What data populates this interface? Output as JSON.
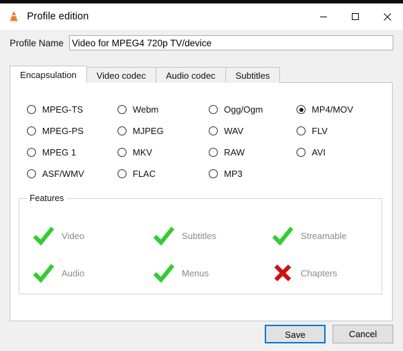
{
  "window": {
    "title": "Profile edition",
    "app_icon": "vlc-cone-icon",
    "controls": {
      "minimize": "minimize-icon",
      "maximize": "maximize-icon",
      "close": "close-icon"
    }
  },
  "profile": {
    "label": "Profile Name",
    "value": "Video for MPEG4 720p TV/device",
    "placeholder": ""
  },
  "tabs": [
    {
      "label": "Encapsulation",
      "active": true
    },
    {
      "label": "Video codec",
      "active": false
    },
    {
      "label": "Audio codec",
      "active": false
    },
    {
      "label": "Subtitles",
      "active": false
    }
  ],
  "encapsulation": {
    "selected": "MP4/MOV",
    "rows": [
      [
        {
          "label": "MPEG-TS",
          "checked": false
        },
        {
          "label": "Webm",
          "checked": false
        },
        {
          "label": "Ogg/Ogm",
          "checked": false
        },
        {
          "label": "MP4/MOV",
          "checked": true
        }
      ],
      [
        {
          "label": "MPEG-PS",
          "checked": false
        },
        {
          "label": "MJPEG",
          "checked": false
        },
        {
          "label": "WAV",
          "checked": false
        },
        {
          "label": "FLV",
          "checked": false
        }
      ],
      [
        {
          "label": "MPEG 1",
          "checked": false
        },
        {
          "label": "MKV",
          "checked": false
        },
        {
          "label": "RAW",
          "checked": false
        },
        {
          "label": "AVI",
          "checked": false
        }
      ],
      [
        {
          "label": "ASF/WMV",
          "checked": false
        },
        {
          "label": "FLAC",
          "checked": false
        },
        {
          "label": "MP3",
          "checked": false
        },
        {
          "label": "",
          "checked": false
        }
      ]
    ]
  },
  "features": {
    "legend": "Features",
    "rows": [
      [
        {
          "label": "Video",
          "state": "yes",
          "icon": "check-icon"
        },
        {
          "label": "Subtitles",
          "state": "yes",
          "icon": "check-icon"
        },
        {
          "label": "Streamable",
          "state": "yes",
          "icon": "check-icon"
        }
      ],
      [
        {
          "label": "Audio",
          "state": "yes",
          "icon": "check-icon"
        },
        {
          "label": "Menus",
          "state": "yes",
          "icon": "check-icon"
        },
        {
          "label": "Chapters",
          "state": "no",
          "icon": "cross-icon"
        }
      ]
    ]
  },
  "buttons": {
    "save": "Save",
    "cancel": "Cancel"
  },
  "colors": {
    "check_green": "#33cc33",
    "cross_red": "#cc1111",
    "focus_blue": "#0078d7",
    "dialog_bg": "#f0f0f0",
    "panel_bg": "#ffffff"
  }
}
